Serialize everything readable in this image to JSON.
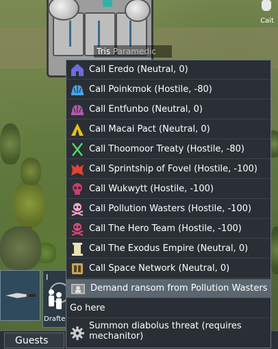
{
  "map": {
    "pawn_name": "Tris",
    "pawn_role": "Paramedic",
    "other_pawn": "Cait"
  },
  "colonist_bar": {
    "slot_number": "I",
    "status_label": "Drafte"
  },
  "bottom_tab": {
    "label": "Guests"
  },
  "menu": {
    "items": [
      {
        "label": "Call Eredo (Neutral, 0)",
        "icon": "faction-house-icon",
        "color": "#6f6ae0"
      },
      {
        "label": "Call Poinkmok (Hostile, -80)",
        "icon": "faction-helmet-icon",
        "color": "#4aa3e6"
      },
      {
        "label": "Call Entfunbo (Neutral, 0)",
        "icon": "faction-helmet-icon",
        "color": "#b45aa8"
      },
      {
        "label": "Call Macai Pact (Neutral, 0)",
        "icon": "faction-tent-icon",
        "color": "#e6c11c"
      },
      {
        "label": "Call Thoomoor Treaty (Hostile, -80)",
        "icon": "faction-crossed-blades-icon",
        "color": "#57d96a"
      },
      {
        "label": "Call Sprintship of Fovel (Hostile, -100)",
        "icon": "faction-beast-icon",
        "color": "#e0432f"
      },
      {
        "label": "Call Wukwytt (Hostile, -100)",
        "icon": "faction-skull-icon",
        "color": "#d23a6a"
      },
      {
        "label": "Call Pollution Wasters (Hostile, -100)",
        "icon": "faction-skull-crossbones-icon",
        "color": "#f2a6c8"
      },
      {
        "label": "Call The Hero Team (Hostile, -100)",
        "icon": "faction-skull-crossbones-icon",
        "color": "#d44a78"
      },
      {
        "label": "Call The Exodus Empire (Neutral, 0)",
        "icon": "faction-pillar-icon",
        "color": "#e8e2b8"
      },
      {
        "label": "Call Space Network (Neutral, 0)",
        "icon": "faction-machine-icon",
        "color": "#c9a35a"
      },
      {
        "label": "Demand ransom from Pollution Wasters",
        "icon": "ransom-prisoner-icon",
        "color": "#b8b8b8"
      },
      {
        "label": "Go here",
        "icon": "",
        "color": ""
      },
      {
        "label": "Summon diabolus threat (requires mechanitor)",
        "icon": "gear-icon",
        "color": "#d0d0d0"
      }
    ]
  }
}
